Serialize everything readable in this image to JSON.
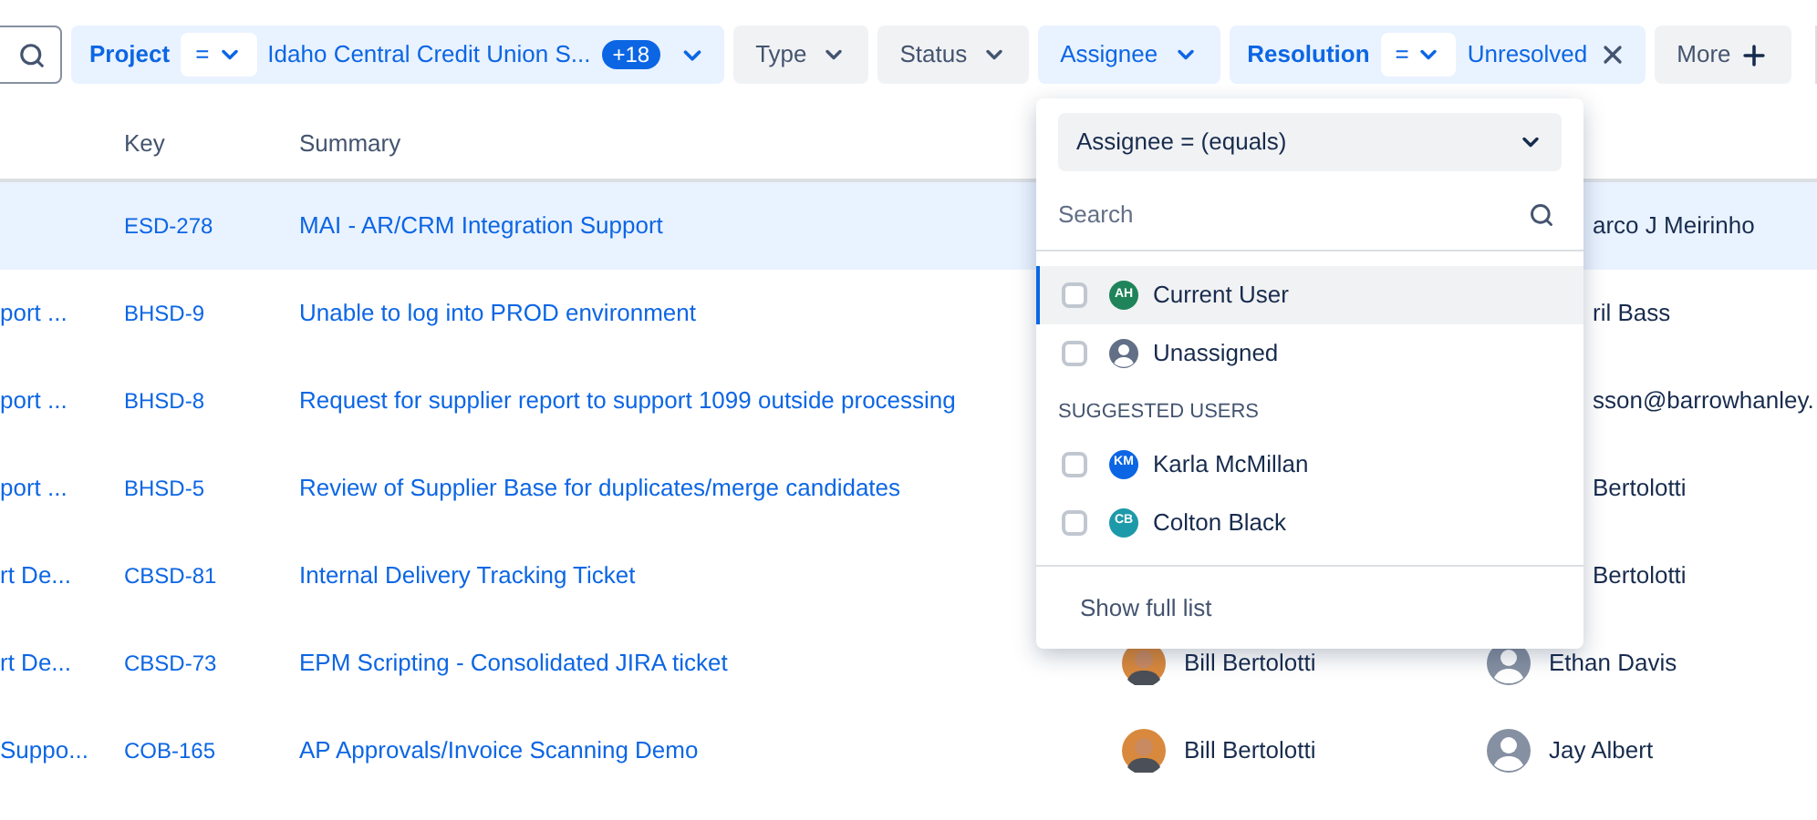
{
  "filters": [
    {
      "kind": "project",
      "label": "Project",
      "operator": "=",
      "value": "Idaho Central Credit Union S...",
      "count": "+18",
      "selected": true
    },
    {
      "kind": "plain",
      "label": "Type",
      "selected": false
    },
    {
      "kind": "plain",
      "label": "Status",
      "selected": false
    },
    {
      "kind": "plain",
      "label": "Assignee",
      "selected": true
    },
    {
      "kind": "resolution",
      "label": "Resolution",
      "operator": "=",
      "value": "Unresolved",
      "selected": true
    },
    {
      "kind": "more",
      "label": "More",
      "selected": false
    }
  ],
  "table": {
    "columns": [
      "Key",
      "Summary"
    ],
    "rows": [
      {
        "column_1": "",
        "key": "ESD-278",
        "summary": "MAI - AR/CRM Integration Support",
        "reporter": {
          "name": "arco J Meirinho"
        },
        "selected": true
      },
      {
        "column_1": "port ...",
        "key": "BHSD-9",
        "summary": "Unable to log into PROD environment",
        "reporter": {
          "name": "ril Bass"
        },
        "selected": false
      },
      {
        "column_1": "port ...",
        "key": "BHSD-8",
        "summary": "Request for supplier report to support 1099 outside processing",
        "reporter": {
          "name": "sson@barrowhanley."
        },
        "selected": false
      },
      {
        "column_1": "port ...",
        "key": "BHSD-5",
        "summary": "Review of Supplier Base for duplicates/merge candidates",
        "reporter": {
          "name": "Bertolotti"
        },
        "selected": false
      },
      {
        "column_1": "rt De...",
        "key": "CBSD-81",
        "summary": "Internal Delivery Tracking Ticket",
        "reporter": {
          "name": "Bertolotti"
        },
        "selected": false
      },
      {
        "column_1": "rt De...",
        "key": "CBSD-73",
        "summary": "EPM Scripting - Consolidated JIRA ticket",
        "assignee": {
          "name": "Bill Bertolotti"
        },
        "reporter": {
          "name": "Ethan Davis",
          "kind": "silhouette"
        },
        "selected": false
      },
      {
        "column_1": "Suppo...",
        "key": "COB-165",
        "summary": "AP Approvals/Invoice Scanning Demo",
        "assignee": {
          "name": "Bill Bertolotti"
        },
        "reporter": {
          "name": "Jay Albert",
          "kind": "silhouette"
        },
        "selected": false
      }
    ]
  },
  "dropdown": {
    "operator": "Assignee = (equals)",
    "search": {
      "placeholder": "Search"
    },
    "items": [
      {
        "kind": "user",
        "name": "Current User",
        "initials": "AH",
        "color": "#1f845a",
        "checked": false,
        "selected": true
      },
      {
        "kind": "unassigned",
        "name": "Unassigned",
        "checked": false,
        "selected": false
      },
      {
        "kind": "heading",
        "name": "SUGGESTED USERS"
      },
      {
        "kind": "user",
        "name": "Karla McMillan",
        "initials": "KM",
        "color": "#0c66e4",
        "checked": false,
        "selected": false
      },
      {
        "kind": "user",
        "name": "Colton Black",
        "initials": "CB",
        "color": "#1d9aaa",
        "checked": false,
        "selected": false
      }
    ],
    "footer": "Show full list"
  }
}
